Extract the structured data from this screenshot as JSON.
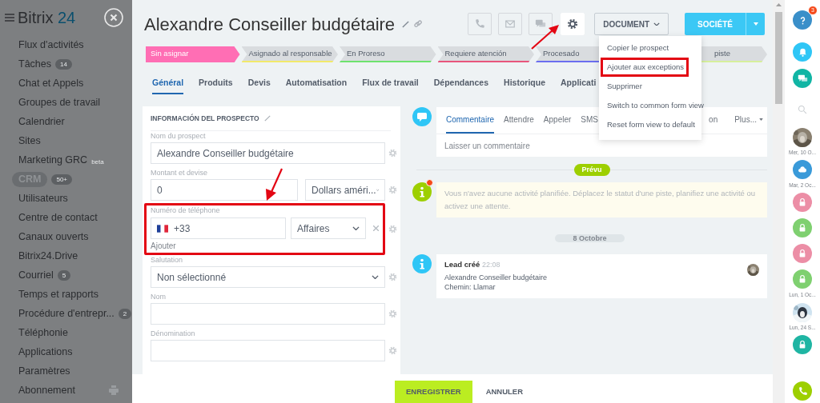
{
  "sidebar": {
    "logo": {
      "name": "Bitrix",
      "number": "24"
    },
    "items": [
      {
        "label": "Flux d'activités",
        "selected": false
      },
      {
        "label": "Tâches",
        "counter": "14",
        "selected": false
      },
      {
        "label": "Chat et Appels",
        "selected": false
      },
      {
        "label": "Groupes de travail",
        "selected": false
      },
      {
        "label": "Calendrier",
        "selected": false
      },
      {
        "label": "Sites",
        "selected": false
      },
      {
        "label": "Marketing GRC",
        "tag": "beta",
        "selected": false
      },
      {
        "label": "CRM",
        "counter": "50+",
        "selected": true
      },
      {
        "label": "Utilisateurs",
        "selected": false
      },
      {
        "label": "Centre de contact",
        "selected": false
      },
      {
        "label": "Canaux ouverts",
        "selected": false
      },
      {
        "label": "Bitrix24.Drive",
        "selected": false
      },
      {
        "label": "Courriel",
        "counter": "5",
        "selected": false
      },
      {
        "label": "Temps et rapports",
        "selected": false
      },
      {
        "label": "Procédure d'entrepr...",
        "counter": "2",
        "selected": false
      },
      {
        "label": "Téléphonie",
        "selected": false
      },
      {
        "label": "Applications",
        "selected": false
      },
      {
        "label": "Paramètres",
        "selected": false
      },
      {
        "label": "Abonnement",
        "selected": false
      }
    ]
  },
  "header": {
    "title": "Alexandre Conseiller budgétaire",
    "icon_buttons": [
      {
        "kind": "phone",
        "disabled": true,
        "pointed": false
      },
      {
        "kind": "mail",
        "disabled": true,
        "pointed": false
      },
      {
        "kind": "chat",
        "disabled": true,
        "pointed": false
      },
      {
        "kind": "gear",
        "disabled": false,
        "pointed": true
      }
    ],
    "document_button": "DOCUMENT",
    "primary_button": "SOCIÉTÉ"
  },
  "stages": [
    {
      "label": "Sin asignar",
      "selected": true,
      "color": "#ff6eb4"
    },
    {
      "label": "Asignado al responsable",
      "selected": false,
      "color": "#f2e96b"
    },
    {
      "label": "En Proreso",
      "selected": false,
      "color": "#6ee36e"
    },
    {
      "label": "Requiere atención",
      "selected": false,
      "color": "#e8557c"
    },
    {
      "label": "Procesado",
      "selected": false,
      "color": "#6b6ef0"
    },
    {
      "label": "piste",
      "selected": false,
      "color": "#d6ef9c"
    }
  ],
  "tabs": [
    {
      "label": "Général",
      "selected": true
    },
    {
      "label": "Produits",
      "selected": false
    },
    {
      "label": "Devis",
      "selected": false
    },
    {
      "label": "Automatisation",
      "selected": false
    },
    {
      "label": "Flux de travail",
      "selected": false
    },
    {
      "label": "Dépendances",
      "selected": false
    },
    {
      "label": "Historique",
      "selected": false
    },
    {
      "label": "Applicati",
      "selected": false
    }
  ],
  "menu": {
    "items": [
      {
        "label": "Copier le prospect",
        "highlighted": false
      },
      {
        "label": "Ajouter aux exceptions",
        "highlighted": true
      },
      {
        "label": "Supprimer",
        "highlighted": false
      },
      {
        "label": "Switch to common form view",
        "highlighted": false
      },
      {
        "label": "Reset form view to default",
        "highlighted": false
      }
    ]
  },
  "form": {
    "title": "INFORMACIÓN DEL PROSPECTO",
    "fields": [
      {
        "kind": "text",
        "label": "Nom du prospect",
        "value": "Alexandre Conseiller budgétaire"
      },
      {
        "kind": "money",
        "label": "Montant et devise",
        "value": "0",
        "currency": "Dollars améri..."
      },
      {
        "kind": "phone",
        "label": "Numéro de téléphone",
        "value": "+33",
        "type": "Affaires",
        "add": "Ajouter",
        "pointed": true
      },
      {
        "kind": "select",
        "label": "Salutation",
        "value": "Non sélectionné"
      },
      {
        "kind": "text",
        "label": "Nom"
      },
      {
        "kind": "text",
        "label": "Dénomination"
      }
    ]
  },
  "timeline": {
    "tabs": [
      {
        "label": "Commentaire",
        "selected": true
      },
      {
        "label": "Attendre",
        "selected": false
      },
      {
        "label": "Appeler",
        "selected": false
      },
      {
        "label": "SMS",
        "selected": false
      },
      {
        "label": "on",
        "selected": false
      }
    ],
    "more": "Plus...",
    "placeholder": "Laisser un commentaire",
    "planned": "Prévu",
    "notice": "Vous n'avez aucune activité planifiée. Déplacez le statut d'une piste, planifiez une activité ou activez une attente.",
    "date": "8 Octobre",
    "entry": {
      "title": "Lead créé",
      "time": "22:08",
      "lines": [
        "Alexandre Conseiller budgétaire",
        "Chemin: Llamar"
      ]
    }
  },
  "footer": {
    "save": "ENREGISTRER",
    "cancel": "ANNULER"
  },
  "rightbar": {
    "top": [
      {
        "kind": "help",
        "badge": "3"
      },
      {
        "kind": "bell"
      },
      {
        "kind": "chat"
      },
      {
        "kind": "search"
      }
    ],
    "items": [
      {
        "kind": "picture",
        "date": "Mer, 10 O..."
      },
      {
        "kind": "cloud",
        "color": "#3a9ad9",
        "date": "Mar, 2 Oc..."
      },
      {
        "kind": "lock",
        "color": "#ec8ea6"
      },
      {
        "kind": "lock",
        "color": "#7fd070"
      },
      {
        "kind": "lock",
        "color": "#ec8ea6"
      },
      {
        "kind": "lock",
        "color": "#7fd070",
        "date": "Lun, 1 Oc..."
      },
      {
        "kind": "picture",
        "date": "Lun, 24 S..."
      },
      {
        "kind": "lock",
        "color": "#1fb5a3"
      }
    ],
    "bottom": {
      "kind": "phone"
    }
  }
}
